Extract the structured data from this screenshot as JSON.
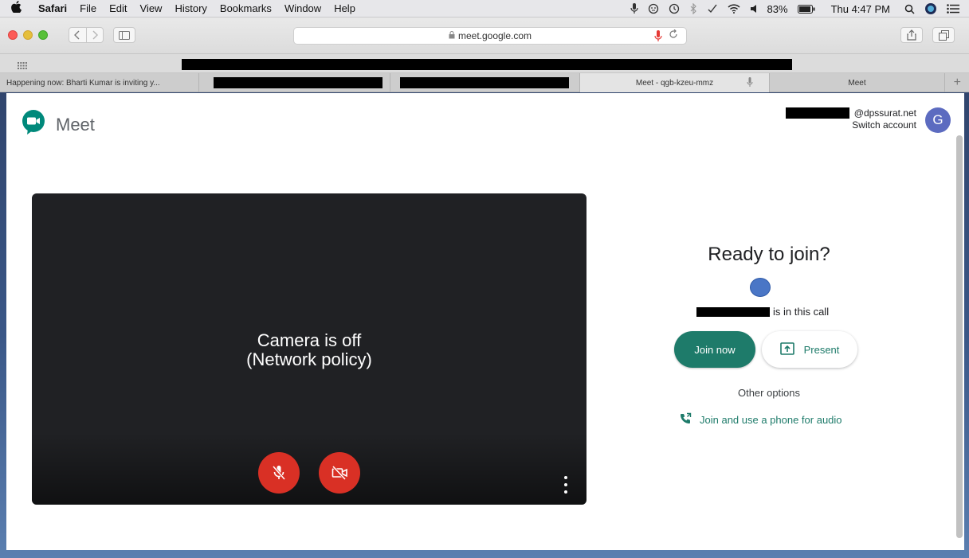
{
  "menubar": {
    "apple": "",
    "items": [
      "Safari",
      "File",
      "Edit",
      "View",
      "History",
      "Bookmarks",
      "Window",
      "Help"
    ],
    "battery": "83%",
    "clock": "Thu 4:47 PM"
  },
  "browser": {
    "url": "meet.google.com",
    "tabs": [
      {
        "label": "Happening now: Bharti Kumar is inviting y..."
      },
      {
        "label": ""
      },
      {
        "label": ""
      },
      {
        "label": "Meet - qgb-kzeu-mmz"
      },
      {
        "label": "Meet"
      }
    ],
    "new_tab": "+"
  },
  "header": {
    "product": "Meet",
    "account_domain": "@dpssurat.net",
    "switch_account": "Switch account",
    "avatar_letter": "G"
  },
  "preview": {
    "camera_line1": "Camera is off",
    "camera_line2": "(Network policy)"
  },
  "join": {
    "title": "Ready to join?",
    "in_call": "is in this call",
    "join_now": "Join now",
    "present": "Present",
    "other_options": "Other options",
    "phone_audio": "Join and use a phone for audio"
  },
  "colors": {
    "accent": "#1e7b6a",
    "danger": "#d93025",
    "avatar": "#5c6bc0"
  }
}
